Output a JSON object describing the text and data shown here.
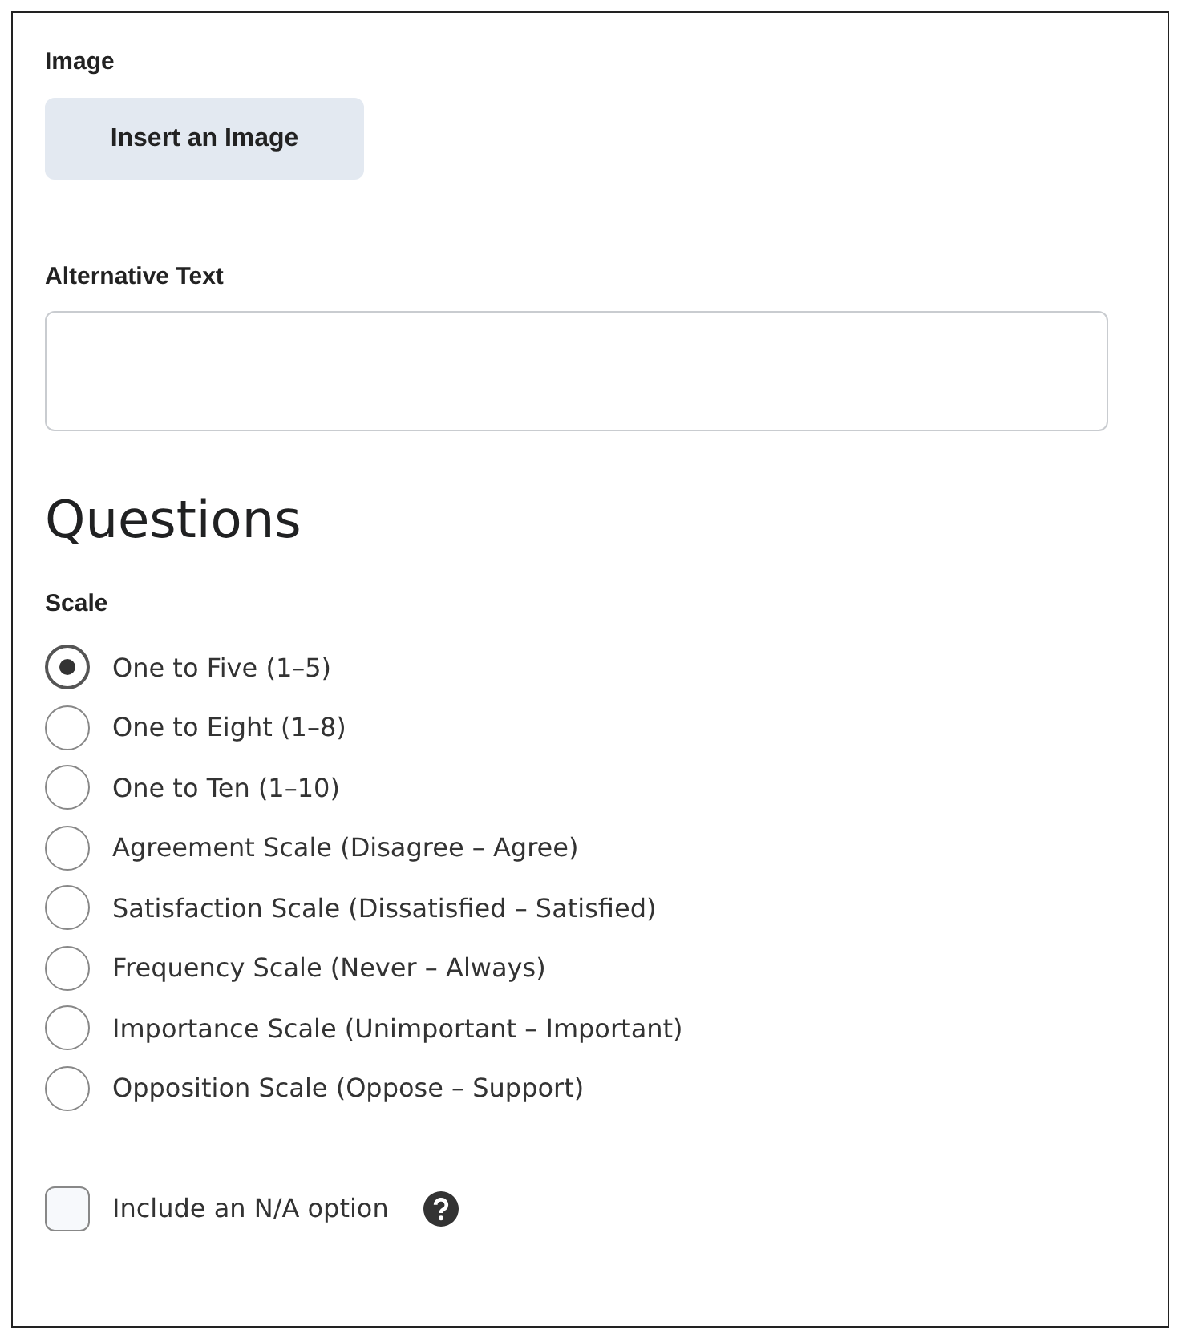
{
  "image_section": {
    "label": "Image",
    "button": "Insert an Image"
  },
  "alt_text": {
    "label": "Alternative Text"
  },
  "questions": {
    "heading": "Questions",
    "scale_label": "Scale",
    "options": [
      {
        "label": "One to Five (1–5)",
        "selected": true
      },
      {
        "label": "One to Eight (1–8)",
        "selected": false
      },
      {
        "label": "One to Ten (1–10)",
        "selected": false
      },
      {
        "label": "Agreement Scale (Disagree – Agree)",
        "selected": false
      },
      {
        "label": "Satisfaction Scale (Dissatisfied – Satisfied)",
        "selected": false
      },
      {
        "label": "Frequency Scale (Never – Always)",
        "selected": false
      },
      {
        "label": "Importance Scale (Unimportant – Important)",
        "selected": false
      },
      {
        "label": "Opposition Scale (Oppose – Support)",
        "selected": false
      }
    ],
    "na_option": {
      "label": "Include an N/A option",
      "checked": false
    }
  }
}
